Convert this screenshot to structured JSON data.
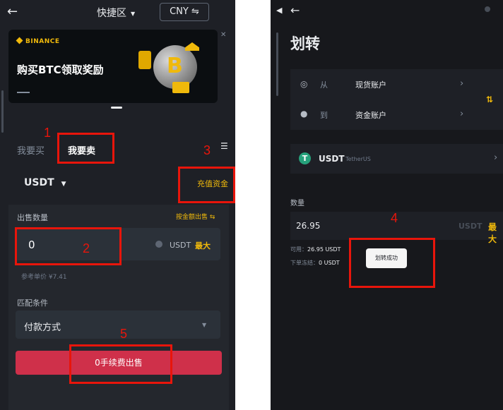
{
  "left": {
    "header": {
      "fast_zone": "快捷区",
      "currency": "CNY"
    },
    "banner": {
      "brand": "BINANCE",
      "title": "购买BTC领取奖励",
      "coin_symbol": "B"
    },
    "tabs": {
      "buy": "我要买",
      "sell": "我要卖"
    },
    "coin": "USDT",
    "deposit": "充值资金",
    "form": {
      "qty_label": "出售数量",
      "by_amount": "按金额出售 ⇆",
      "qty_value": "0",
      "qty_unit": "USDT",
      "max": "最大",
      "ref_price": "参考单价 ¥7.41",
      "match_label": "匹配条件",
      "payment": "付款方式",
      "sell_button": "0手续费出售"
    }
  },
  "right": {
    "title": "划转",
    "from_label": "从",
    "from_account": "现货账户",
    "to_label": "到",
    "to_account": "资金账户",
    "coin": "USDT",
    "coin_name": "TetherUS",
    "qty_label": "数量",
    "amount": "26.95",
    "unit": "USDT",
    "max": "最大",
    "available_label": "可用：",
    "available_value": "26.95 USDT",
    "frozen_label": "下单冻结：",
    "frozen_value": "0 USDT",
    "toast": "划转成功"
  },
  "annotations": [
    "1",
    "2",
    "3",
    "4",
    "5"
  ],
  "colors": {
    "accent": "#f0b90b",
    "sell": "#cf304a",
    "annotation": "#e8150b"
  }
}
